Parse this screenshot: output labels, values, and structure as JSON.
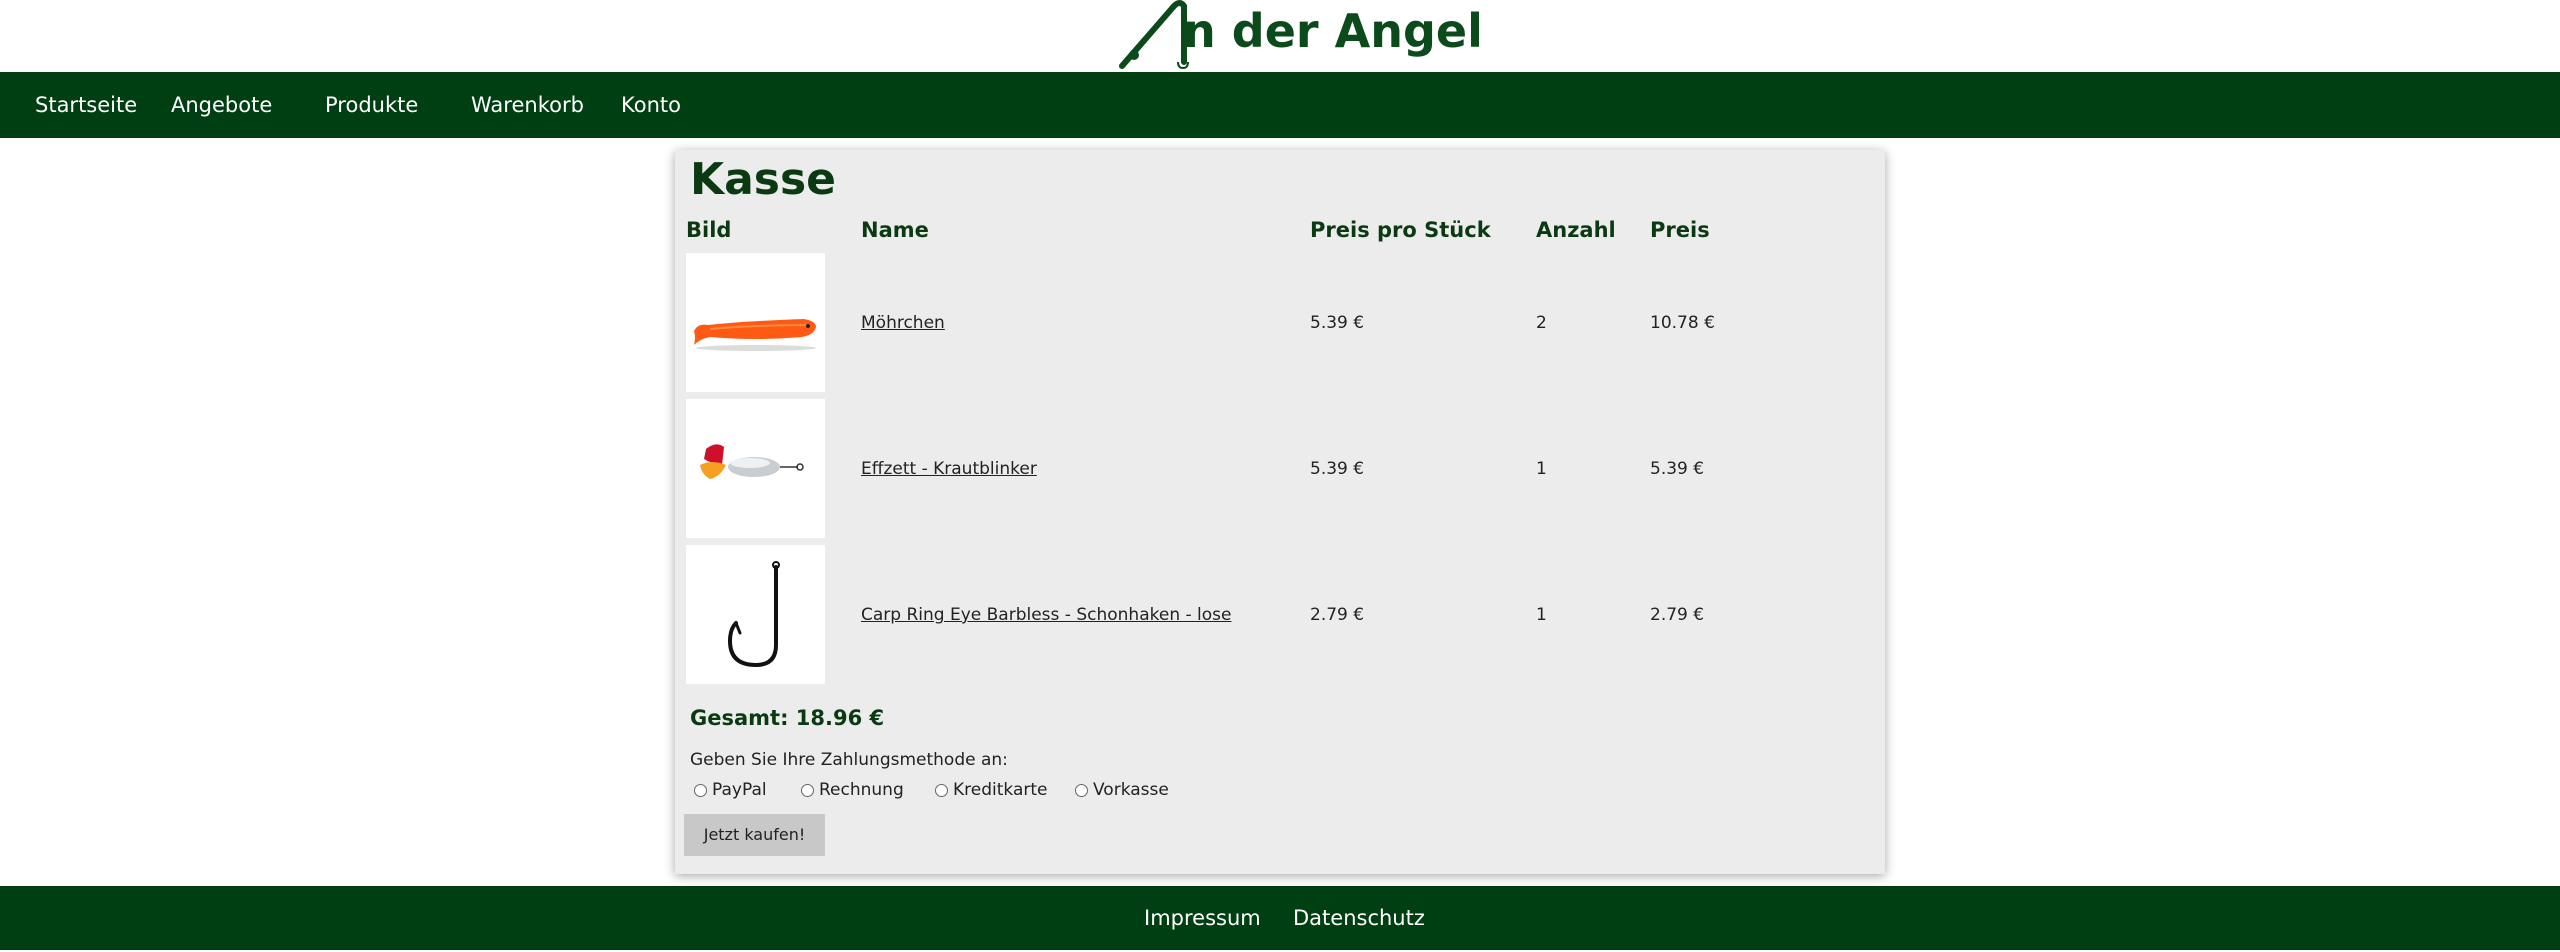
{
  "brand": {
    "logo_text": "n der Angel",
    "color": "#0b4a1a"
  },
  "nav": {
    "color": "#003f12",
    "items": [
      {
        "label": "Startseite"
      },
      {
        "label": "Angebote"
      },
      {
        "label": "Produkte"
      },
      {
        "label": "Warenkorb"
      },
      {
        "label": "Konto"
      }
    ]
  },
  "checkout": {
    "title": "Kasse",
    "columns": {
      "image": "Bild",
      "name": "Name",
      "unit_price": "Preis pro Stück",
      "quantity": "Anzahl",
      "price": "Preis"
    },
    "items": [
      {
        "image_icon": "orange-soft-lure-image",
        "name": "Möhrchen",
        "unit_price": "5.39 €",
        "quantity": "2",
        "price": "10.78 €"
      },
      {
        "image_icon": "spinner-lure-image",
        "name": "Effzett - Krautblinker",
        "unit_price": "5.39 €",
        "quantity": "1",
        "price": "5.39 €"
      },
      {
        "image_icon": "fish-hook-image",
        "name": "Carp Ring Eye Barbless - Schonhaken - lose",
        "unit_price": "2.79 €",
        "quantity": "1",
        "price": "2.79 €"
      }
    ],
    "total": "Gesamt: 18.96 €",
    "payment_prompt": "Geben Sie Ihre Zahlungsmethode an:",
    "payment_options": [
      {
        "label": "PayPal",
        "selected": false
      },
      {
        "label": "Rechnung",
        "selected": false
      },
      {
        "label": "Kreditkarte",
        "selected": false
      },
      {
        "label": "Vorkasse",
        "selected": false
      }
    ],
    "buy_button": "Jetzt kaufen!"
  },
  "footer": {
    "links": [
      {
        "label": "Impressum"
      },
      {
        "label": "Datenschutz"
      }
    ]
  }
}
